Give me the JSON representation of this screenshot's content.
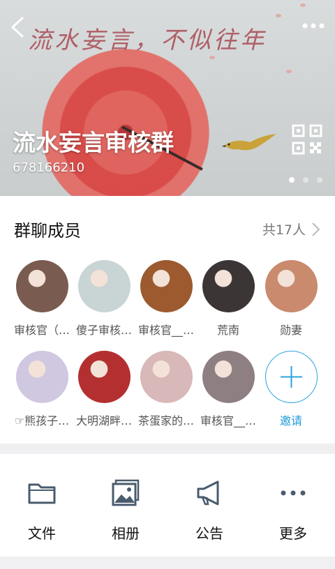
{
  "banner": {
    "calligraphy": "流水妄言，不似往年",
    "group_name": "流水妄言审核群",
    "group_id": "678166210",
    "pages": 3,
    "active_page": 0
  },
  "members_section": {
    "title": "群聊成员",
    "count_label": "共17人",
    "members": [
      {
        "name": "审核官（…",
        "color": "#7a5b4f"
      },
      {
        "name": "傻子审核…",
        "color": "#c9d4d4"
      },
      {
        "name": "审核官__…",
        "color": "#9c5a2e"
      },
      {
        "name": "荒南",
        "color": "#3c3535"
      },
      {
        "name": "勋妻",
        "color": "#c98a6e"
      },
      {
        "name": "☞熊孩子…",
        "color": "#cfc8e0"
      },
      {
        "name": "大明湖畔…",
        "color": "#b43030"
      },
      {
        "name": "茶蛋家的…",
        "color": "#d8b8b8"
      },
      {
        "name": "审核官__…",
        "color": "#8e7f82"
      }
    ],
    "invite_label": "邀请"
  },
  "actions": [
    {
      "label": "文件",
      "icon": "folder-icon"
    },
    {
      "label": "相册",
      "icon": "photo-album-icon"
    },
    {
      "label": "公告",
      "icon": "megaphone-icon"
    },
    {
      "label": "更多",
      "icon": "more-icon"
    }
  ],
  "colors": {
    "accent": "#2aa3e0",
    "icon_gray": "#4a5b6e"
  }
}
